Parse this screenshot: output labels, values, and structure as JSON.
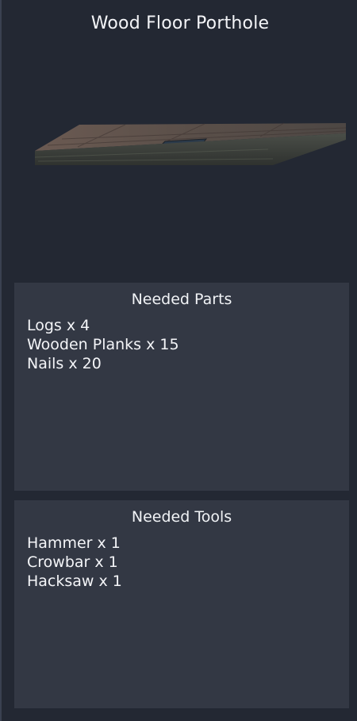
{
  "window": {
    "title": "Wood Floor Porthole"
  },
  "preview": {
    "icon": "wood-floor-porthole-model"
  },
  "needed_parts": {
    "header": "Needed Parts",
    "items": [
      "Logs x 4",
      "Wooden Planks x 15",
      "Nails x 20"
    ]
  },
  "needed_tools": {
    "header": "Needed Tools",
    "items": [
      "Hammer x 1",
      "Crowbar x 1",
      "Hacksaw x 1"
    ]
  },
  "colors": {
    "background": "#232833",
    "box": "#333844",
    "text": "#f4f5f8"
  }
}
